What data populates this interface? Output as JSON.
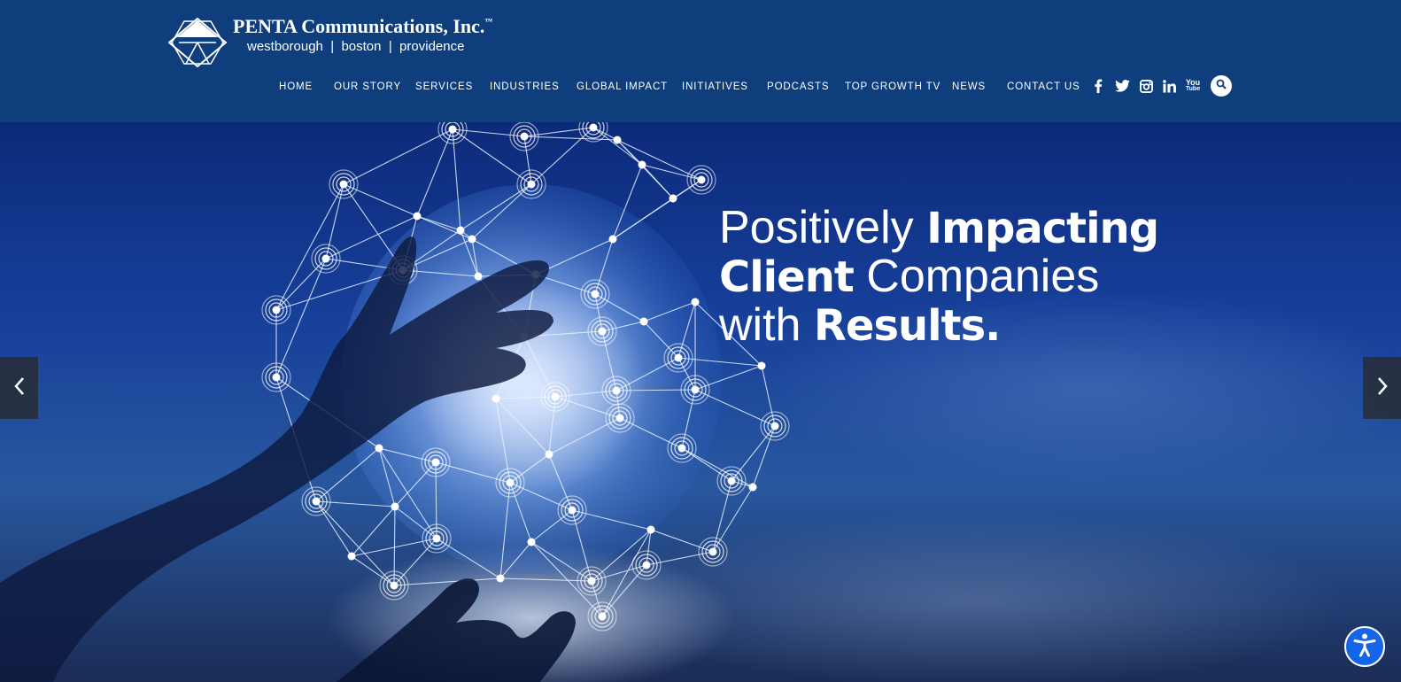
{
  "header": {
    "logo_name": "pc-diamond-logo",
    "company_name": "PENTA Communications, Inc.",
    "trademark": "™",
    "locations": "westborough  |  boston  |  providence"
  },
  "nav": {
    "items": [
      {
        "label": "HOME"
      },
      {
        "label": "OUR STORY"
      },
      {
        "label": "SERVICES"
      },
      {
        "label": "INDUSTRIES"
      },
      {
        "label": "GLOBAL IMPACT"
      },
      {
        "label": "INITIATIVES"
      },
      {
        "label": "PODCASTS"
      },
      {
        "label": "TOP GROWTH TV"
      },
      {
        "label": "NEWS"
      },
      {
        "label": "CONTACT US"
      }
    ]
  },
  "social": {
    "icons": [
      "facebook-icon",
      "twitter-icon",
      "instagram-icon",
      "linkedin-icon",
      "youtube-icon"
    ],
    "youtube_text_top": "You",
    "youtube_text_bottom": "Tube"
  },
  "search": {
    "icon": "search-icon"
  },
  "hero": {
    "line1_light": "Positively ",
    "line1_bold": "Impacting",
    "line2_bold": "Client",
    "line2_light": " Companies",
    "line3_light": "with ",
    "line3_bold": "Results."
  },
  "slider": {
    "prev_icon": "chevron-left-icon",
    "next_icon": "chevron-right-icon"
  },
  "accessibility": {
    "icon": "accessibility-icon"
  },
  "colors": {
    "header_bg": "#0e3e7c",
    "accessibility_blue": "#1565e8"
  }
}
